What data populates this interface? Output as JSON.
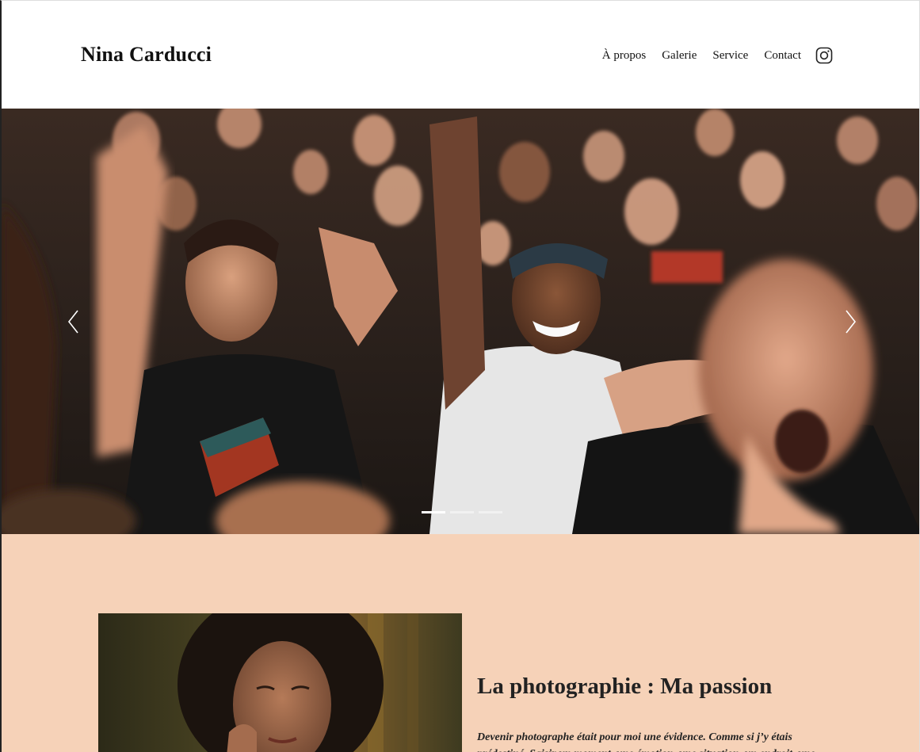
{
  "header": {
    "brand": "Nina Carducci",
    "nav": [
      {
        "label": "À propos"
      },
      {
        "label": "Galerie"
      },
      {
        "label": "Service"
      },
      {
        "label": "Contact"
      }
    ],
    "instagram_icon": "instagram-icon"
  },
  "carousel": {
    "image": "concert-crowd-photo",
    "prev_icon": "chevron-left-icon",
    "next_icon": "chevron-right-icon",
    "slides_count": 3,
    "active_slide": 1
  },
  "about": {
    "portrait": "woman-portrait-photo",
    "title": "La photographie : Ma passion",
    "text": "Devenir photographe était pour moi une évidence. Comme si j’y étais prédestiné. Saisir un moment, une émotion, une situation, un endroit, une"
  },
  "colors": {
    "about_background": "#f6d2b8",
    "text": "#111111"
  }
}
